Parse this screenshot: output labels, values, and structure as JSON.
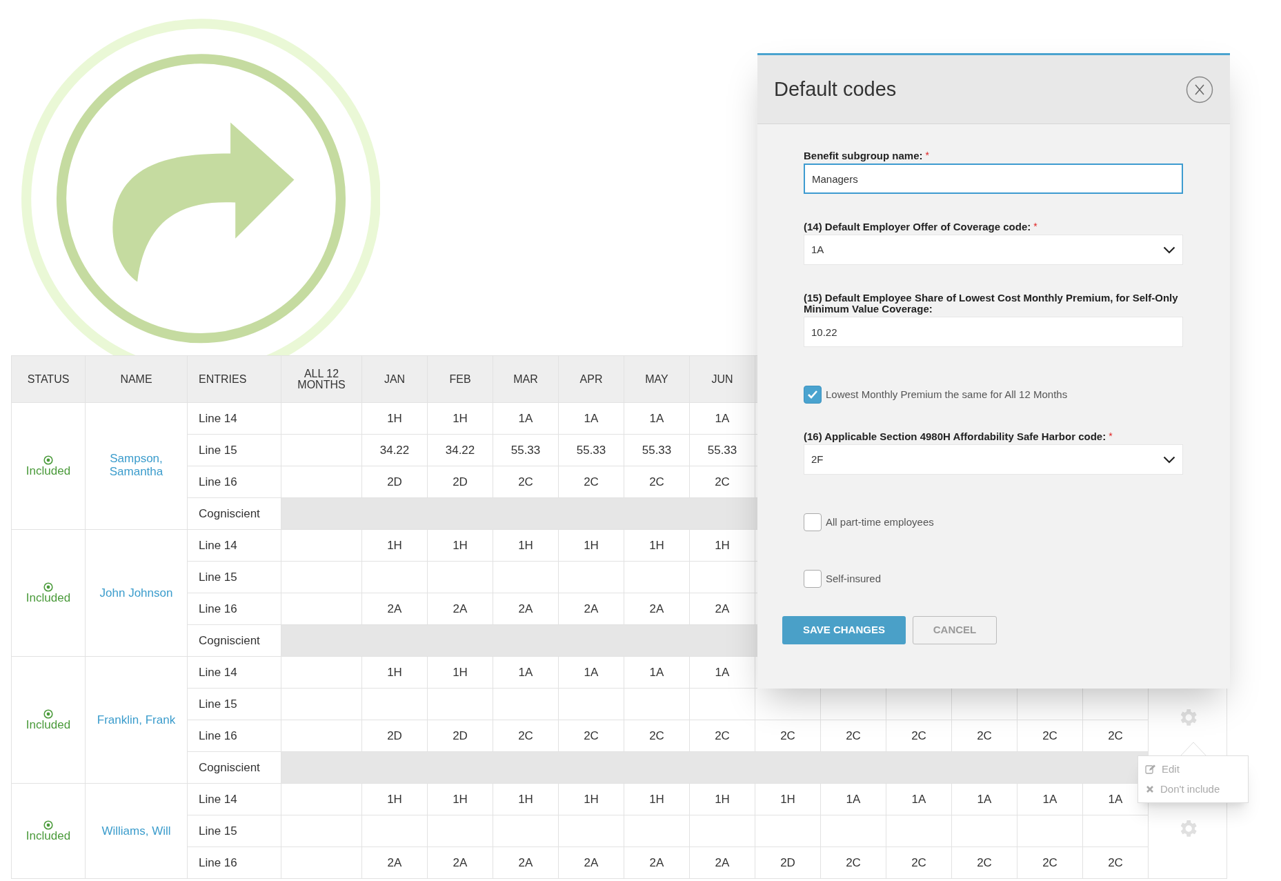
{
  "table": {
    "columns": [
      "STATUS",
      "NAME",
      "ENTRIES",
      "ALL 12 MONTHS",
      "JAN",
      "FEB",
      "MAR",
      "APR",
      "MAY",
      "JUN"
    ],
    "groups": [
      {
        "status": "Included",
        "name": "Sampson, Samantha",
        "gear_shown": false,
        "rows": [
          {
            "kind": "codes",
            "entry": "Line 14",
            "values": [
              "1H",
              "1H",
              "1A",
              "1A",
              "1A",
              "1A"
            ]
          },
          {
            "kind": "codes",
            "entry": "Line 15",
            "values": [
              "34.22",
              "34.22",
              "55.33",
              "55.33",
              "55.33",
              "55.33"
            ]
          },
          {
            "kind": "codes",
            "entry": "Line 16",
            "values": [
              "2D",
              "2D",
              "2C",
              "2C",
              "2C",
              "2C"
            ]
          },
          {
            "kind": "band",
            "entry": "Cogniscient"
          }
        ]
      },
      {
        "status": "Included",
        "name": "John Johnson",
        "gear_shown": false,
        "rows": [
          {
            "kind": "codes",
            "entry": "Line 14",
            "values": [
              "1H",
              "1H",
              "1H",
              "1H",
              "1H",
              "1H"
            ]
          },
          {
            "kind": "codes",
            "entry": "Line 15"
          },
          {
            "kind": "codes",
            "entry": "Line 16",
            "values": [
              "2A",
              "2A",
              "2A",
              "2A",
              "2A",
              "2A"
            ]
          },
          {
            "kind": "band",
            "entry": "Cogniscient"
          }
        ]
      },
      {
        "status": "Included",
        "name": "Franklin, Frank",
        "gear_shown": true,
        "rows": [
          {
            "kind": "codes",
            "entry": "Line 14",
            "values": [
              "1H",
              "1H",
              "1A",
              "1A",
              "1A",
              "1A"
            ]
          },
          {
            "kind": "codes",
            "entry": "Line 15"
          },
          {
            "kind": "codes",
            "entry": "Line 16",
            "values": [
              "2D",
              "2D",
              "2C",
              "2C",
              "2C",
              "2C",
              "2C",
              "2C",
              "2C",
              "2C",
              "2C",
              "2C"
            ]
          },
          {
            "kind": "band",
            "entry": "Cogniscient"
          }
        ]
      },
      {
        "status": "Included",
        "name": "Williams, Will",
        "gear_shown": true,
        "rows": [
          {
            "kind": "codes",
            "entry": "Line 14",
            "values": [
              "1H",
              "1H",
              "1H",
              "1H",
              "1H",
              "1H",
              "1H",
              "1A",
              "1A",
              "1A",
              "1A",
              "1A"
            ]
          },
          {
            "kind": "codes",
            "entry": "Line 15"
          },
          {
            "kind": "codes",
            "entry": "Line 16",
            "values": [
              "2A",
              "2A",
              "2A",
              "2A",
              "2A",
              "2A",
              "2D",
              "2C",
              "2C",
              "2C",
              "2C",
              "2C"
            ]
          }
        ]
      }
    ]
  },
  "menu": {
    "items": [
      {
        "kind": "edit",
        "label": "Edit"
      },
      {
        "kind": "exclude",
        "label": "Don't include"
      }
    ]
  },
  "dialog": {
    "title": "Default codes",
    "fields": [
      {
        "kind": "text",
        "label": "Benefit subgroup name:",
        "required_mark": "*",
        "value": "Managers",
        "focused": true
      },
      {
        "kind": "select",
        "label": "(14) Default Employer Offer of Coverage code:",
        "required_mark": "*",
        "value": "1A",
        "focused": false
      },
      {
        "kind": "text",
        "label": "(15) Default Employee Share of Lowest Cost Monthly Premium, for Self-Only Minimum Value Coverage:",
        "value": "10.22",
        "focused": false
      },
      {
        "kind": "checkbox",
        "label": "Lowest Monthly Premium the same for All 12 Months",
        "checked": true
      },
      {
        "kind": "select",
        "label": "(16) Applicable Section 4980H Affordability Safe Harbor code:",
        "required_mark": "*",
        "value": "2F",
        "focused": false
      },
      {
        "kind": "checkbox",
        "label": "All part-time employees",
        "checked": false
      },
      {
        "kind": "checkbox",
        "label": "Self-insured",
        "checked": false
      }
    ],
    "buttons": [
      {
        "label": "SAVE CHANGES",
        "primary": true
      },
      {
        "label": "CANCEL",
        "primary": false
      }
    ]
  }
}
